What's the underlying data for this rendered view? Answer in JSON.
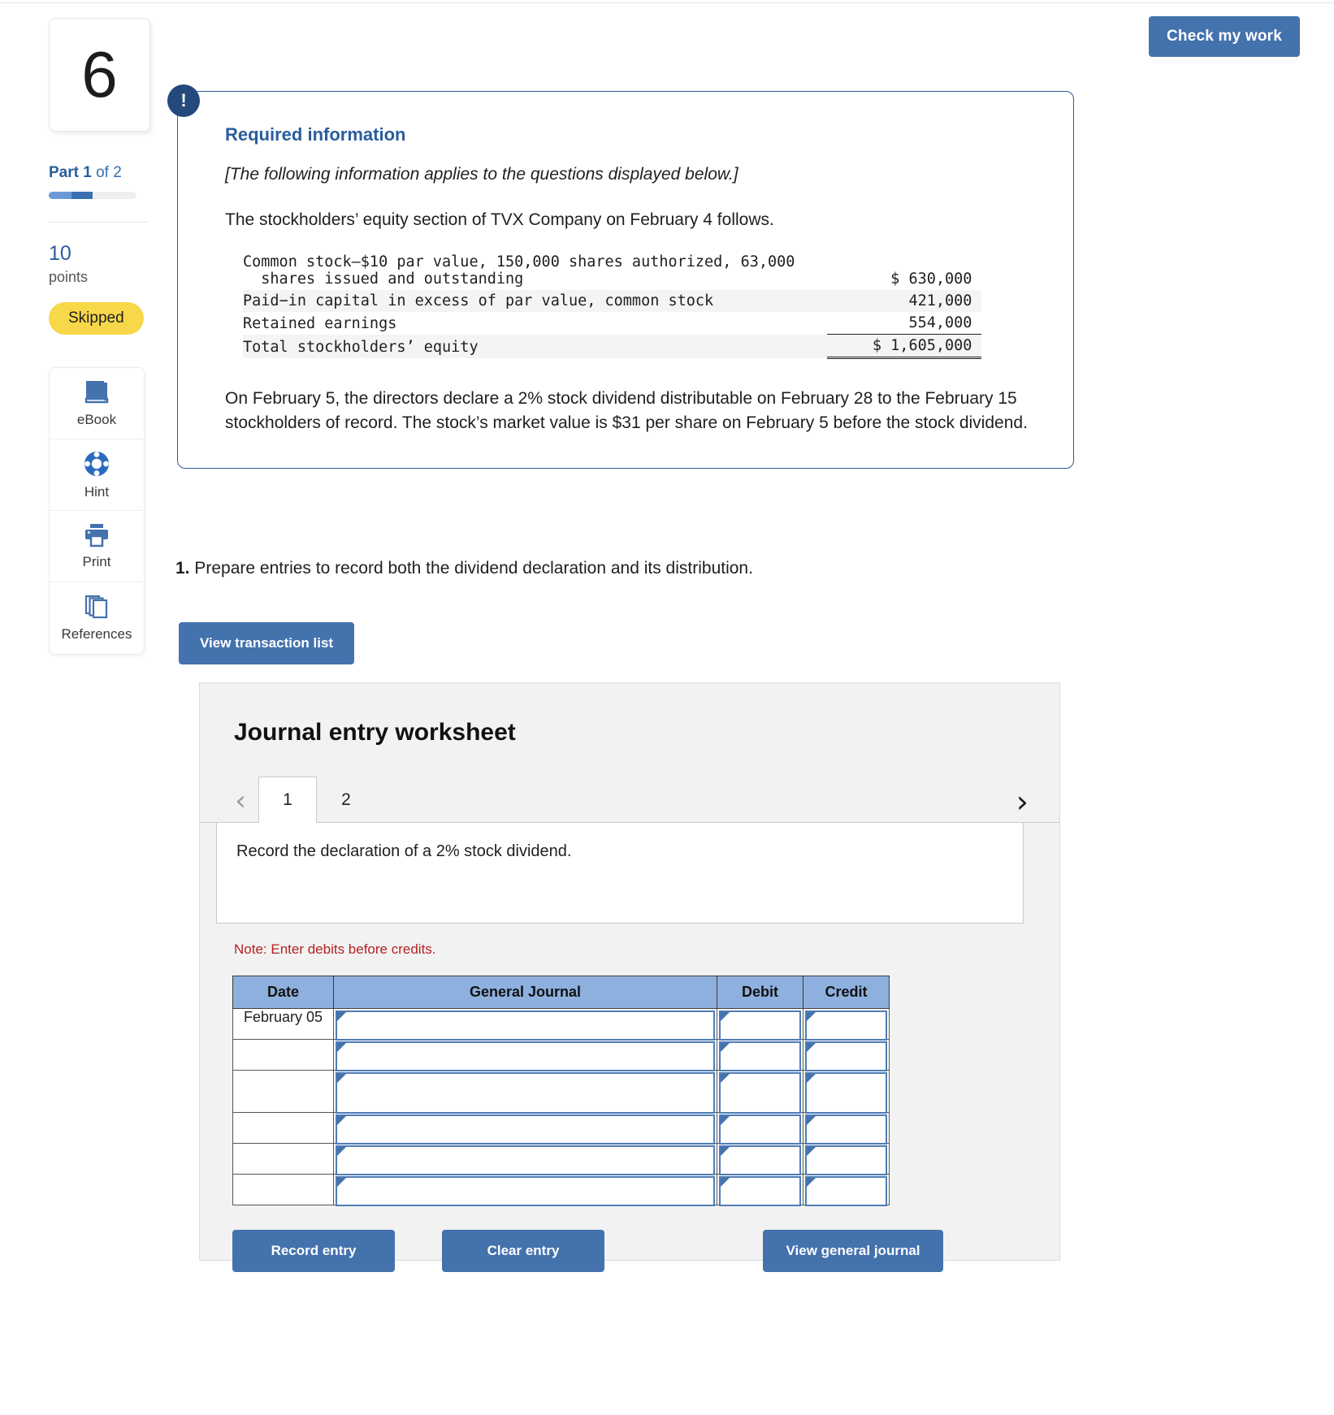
{
  "header": {
    "check_my_work_label": "Check my work"
  },
  "sidebar": {
    "question_number": "6",
    "part_prefix": "Part ",
    "part_current": "1",
    "part_suffix": " of 2",
    "points_value": "10",
    "points_label": "points",
    "status_badge": "Skipped",
    "tools": [
      {
        "icon": "ebook-icon",
        "label": "eBook"
      },
      {
        "icon": "hint-lifesaver-icon",
        "label": "Hint"
      },
      {
        "icon": "printer-icon",
        "label": "Print"
      },
      {
        "icon": "references-copy-icon",
        "label": "References"
      }
    ]
  },
  "callout": {
    "badge_icon": "exclamation-icon",
    "title": "Required information",
    "applies_note": "[The following information applies to the questions displayed below.]",
    "lede": "The stockholders’ equity section of TVX Company on February 4 follows.",
    "equity_rows": [
      {
        "label": "Common stock—$10 par value, 150,000 shares authorized, 63,000\n  shares issued and outstanding",
        "amount": "$ 630,000"
      },
      {
        "label": "Paid−in capital in excess of par value, common stock",
        "amount": "421,000"
      },
      {
        "label": "Retained earnings",
        "amount": "554,000"
      },
      {
        "label": "Total stockholders’ equity",
        "amount": "$ 1,605,000"
      }
    ],
    "closing_paragraph": "On February 5, the directors declare a 2% stock dividend distributable on February 28 to the February 15 stockholders of record. The stock’s market value is $31 per share on February 5 before the stock dividend."
  },
  "question": {
    "number": "1.",
    "text": "Prepare entries to record both the dividend declaration and its distribution.",
    "view_transaction_list_label": "View transaction list"
  },
  "worksheet": {
    "title": "Journal entry worksheet",
    "prev_icon": "chevron-left-icon",
    "next_icon": "chevron-right-icon",
    "tabs": [
      {
        "label": "1",
        "active": true
      },
      {
        "label": "2",
        "active": false
      }
    ],
    "prompt": "Record the declaration of a 2% stock dividend.",
    "note": "Note: Enter debits before credits.",
    "columns": [
      "Date",
      "General Journal",
      "Debit",
      "Credit"
    ],
    "rows": [
      {
        "date": "February 05",
        "general_journal": "",
        "debit": "",
        "credit": ""
      },
      {
        "date": "",
        "general_journal": "",
        "debit": "",
        "credit": ""
      },
      {
        "date": "",
        "general_journal": "",
        "debit": "",
        "credit": ""
      },
      {
        "date": "",
        "general_journal": "",
        "debit": "",
        "credit": ""
      },
      {
        "date": "",
        "general_journal": "",
        "debit": "",
        "credit": ""
      },
      {
        "date": "",
        "general_journal": "",
        "debit": "",
        "credit": ""
      }
    ],
    "buttons": {
      "record": "Record entry",
      "clear": "Clear entry",
      "view_general_journal": "View general journal"
    }
  },
  "colors": {
    "primary_blue": "#4472ad",
    "dark_navy": "#24497d",
    "link_blue": "#2a5d9e",
    "table_header_blue": "#8eb0de",
    "badge_yellow": "#f7d849",
    "note_red": "#b42020",
    "panel_gray": "#f2f2f2"
  }
}
